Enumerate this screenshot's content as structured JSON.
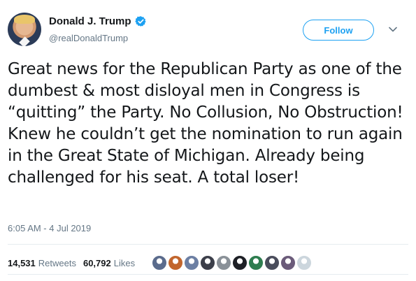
{
  "author": {
    "display_name": "Donald J. Trump",
    "handle": "@realDonaldTrump",
    "verified": true
  },
  "follow_button": {
    "label": "Follow"
  },
  "tweet": {
    "text": "Great news for the Republican Party as one of the dumbest & most disloyal men in Congress is “quitting” the Party. No Collusion, No Obstruction! Knew he couldn’t get the nomination to run again in the Great State of Michigan. Already being challenged for his seat. A total loser!",
    "timestamp": "6:05 AM - 4 Jul 2019"
  },
  "stats": {
    "retweets_count": "14,531",
    "retweets_label": "Retweets",
    "likes_count": "60,792",
    "likes_label": "Likes"
  },
  "likers": [
    {
      "icon": "liker-avatar-icon",
      "color": "#5a6b8c"
    },
    {
      "icon": "liker-avatar-icon",
      "color": "#c2662d"
    },
    {
      "icon": "liker-avatar-icon",
      "color": "#6c7fa3"
    },
    {
      "icon": "liker-avatar-icon",
      "color": "#3c3f4a"
    },
    {
      "icon": "liker-avatar-icon",
      "color": "#8a9198"
    },
    {
      "icon": "liker-avatar-icon",
      "color": "#1e2026"
    },
    {
      "icon": "liker-avatar-icon",
      "color": "#2e7d4f"
    },
    {
      "icon": "liker-avatar-icon",
      "color": "#4a4d5c"
    },
    {
      "icon": "liker-avatar-icon",
      "color": "#6b5b7a"
    },
    {
      "icon": "liker-avatar-icon",
      "color": "#ccd6dd"
    }
  ],
  "colors": {
    "accent": "#1da1f2",
    "text_primary": "#14171a",
    "text_secondary": "#657786",
    "divider": "#e6ecf0"
  }
}
